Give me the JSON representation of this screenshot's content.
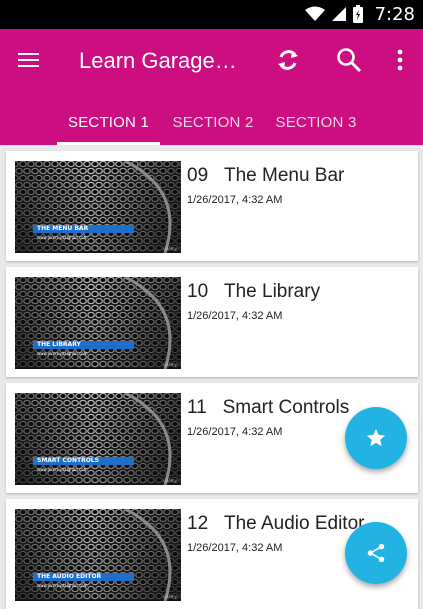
{
  "status_bar": {
    "time": "7:28",
    "icons": [
      "wifi-icon",
      "signal-icon",
      "battery-icon"
    ]
  },
  "app_bar": {
    "title": "Learn GarageM…",
    "actions": [
      "refresh-icon",
      "search-icon",
      "more-vert-icon"
    ],
    "background": "#cc0e80"
  },
  "tabs": [
    {
      "label": "SECTION 1"
    },
    {
      "label": "SECTION 2"
    },
    {
      "label": "SECTION 3"
    }
  ],
  "videos": [
    {
      "number": "09",
      "title": "The Menu Bar",
      "date": "1/26/2017, 4:32 AM",
      "thumb_caption": "THE MENU BAR",
      "thumb_url": "www.jeremydalghan.com"
    },
    {
      "number": "10",
      "title": "The Library",
      "date": "1/26/2017, 4:32 AM",
      "thumb_caption": "THE LIBRARY",
      "thumb_url": "www.jeremydalghan.com"
    },
    {
      "number": "11",
      "title": "Smart Controls",
      "date": "1/26/2017, 4:32 AM",
      "thumb_caption": "SMART CONTROLS",
      "thumb_url": "www.jeremydalghan.com"
    },
    {
      "number": "12",
      "title": "The Audio Editor",
      "date": "1/26/2017, 4:32 AM",
      "thumb_caption": "THE AUDIO EDITOR",
      "thumb_url": "www.jeremydalghan.com"
    }
  ],
  "fabs": [
    "star-icon",
    "share-icon"
  ],
  "colors": {
    "accent": "#22b3e3",
    "primary": "#cc0e80"
  }
}
